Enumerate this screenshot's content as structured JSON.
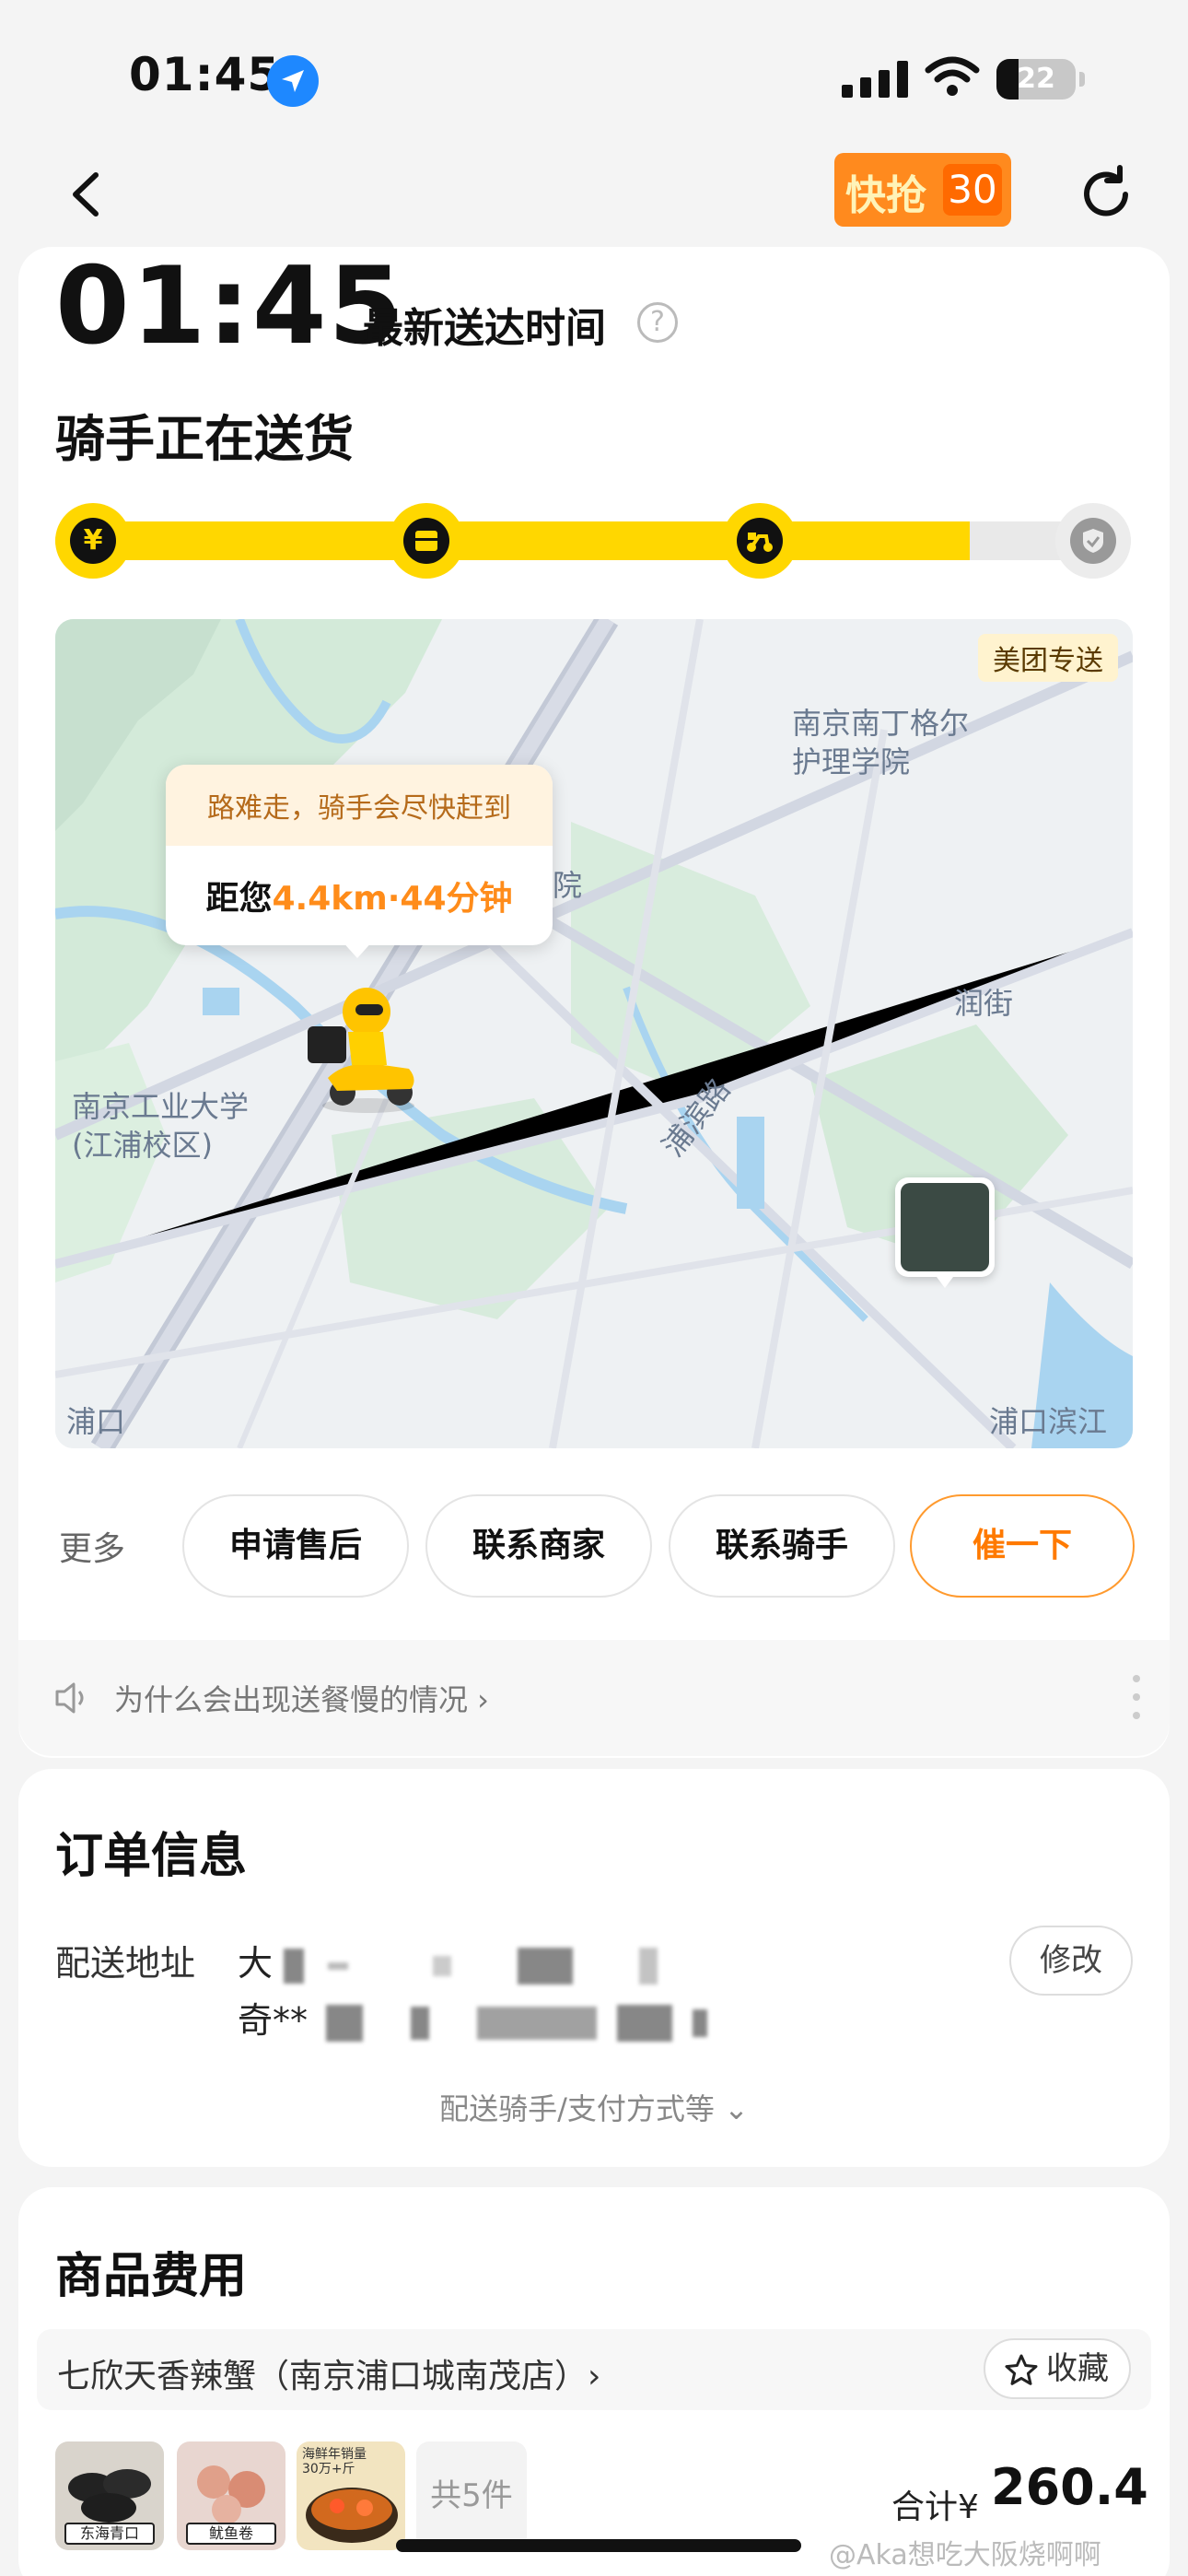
{
  "status_bar": {
    "time": "01:45",
    "battery": "22"
  },
  "header": {
    "promo_text": "快抢",
    "promo_count": "30"
  },
  "eta": {
    "time": "01:45",
    "label": "最新送达时间",
    "help": "?"
  },
  "delivery": {
    "status": "骑手正在送货"
  },
  "progress": {
    "steps": [
      "¥",
      "",
      "",
      ""
    ],
    "fraction": 0.85
  },
  "map": {
    "badge": "美团专送",
    "labels": [
      "南京南丁格尔\n护理学院",
      "润街",
      "南京工业大学\n(江浦校区)",
      "浦滨路",
      "浦口滨江",
      "浦口",
      "院"
    ],
    "tooltip": {
      "warn": "路难走，骑手会尽快赶到",
      "prefix": "距您",
      "distance": "4.4km·44分钟"
    }
  },
  "actions": {
    "more": "更多",
    "buttons": [
      "申请售后",
      "联系商家",
      "联系骑手",
      "催一下"
    ]
  },
  "notice": {
    "text": "为什么会出现送餐慢的情况 ›"
  },
  "order": {
    "title": "订单信息",
    "address_label": "配送地址",
    "address_line1": "大",
    "address_line2": "奇**",
    "modify": "修改",
    "expand": "配送骑手/支付方式等 ⌄"
  },
  "goods": {
    "title": "商品费用",
    "shop_name": "七欣天香辣蟹（南京浦口城南茂店）›",
    "favorite": "收藏",
    "thumbs": [
      "东海青口",
      "鱿鱼卷",
      "海鲜年销量\n30万+斤"
    ],
    "count": "共5件",
    "total_label": "合计¥",
    "total_value": "260.4"
  },
  "watermark": "@Aka想吃大阪烧啊啊",
  "colors": {
    "accent_yellow": "#ffd700",
    "accent_orange": "#ff8c1a"
  }
}
